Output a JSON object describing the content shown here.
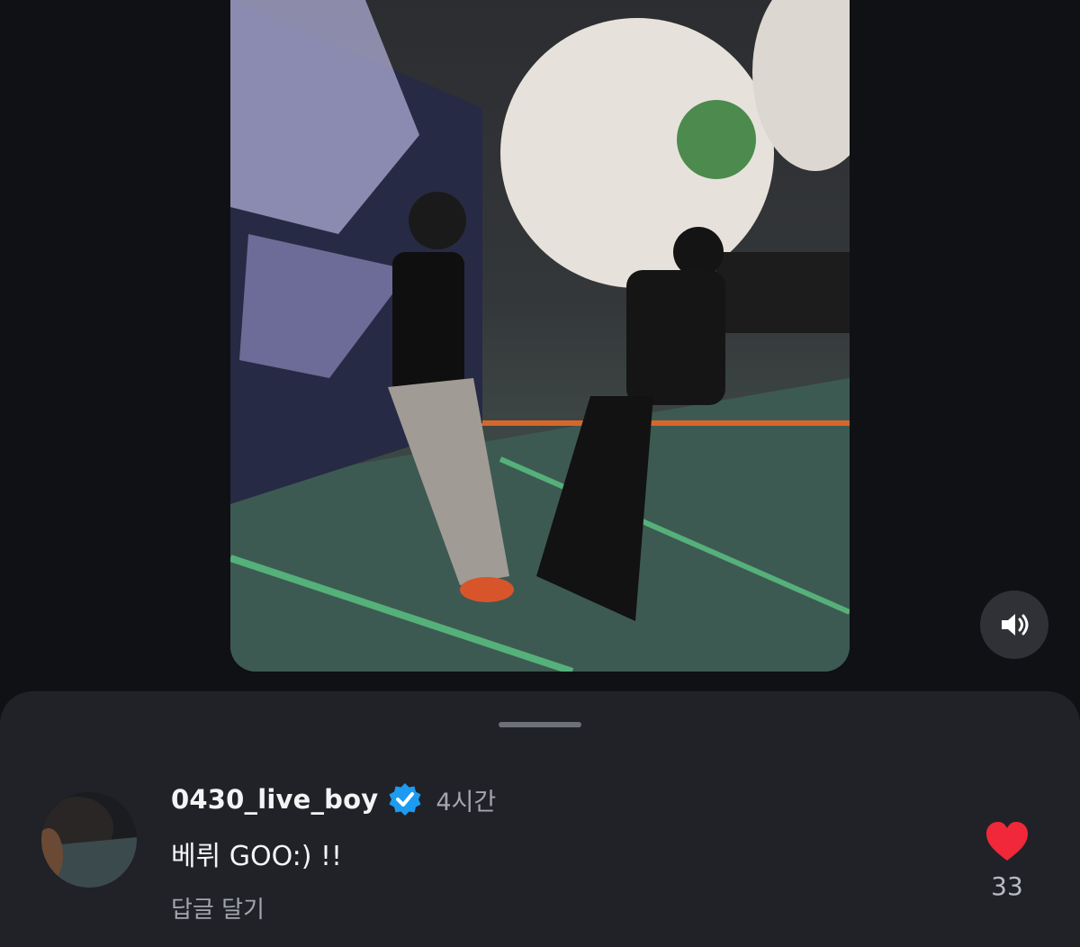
{
  "video": {
    "alt": "video",
    "sound": {
      "icon": "speaker-icon",
      "state": "on"
    }
  },
  "comment": {
    "username": "0430_live_boy",
    "verified_icon": "verified-badge-icon",
    "time": "4시간",
    "text": "베뤼 GOO:) !!",
    "reply_label": "답글 달기",
    "likes": {
      "icon": "heart-icon",
      "count": "33",
      "liked": true,
      "color": "#f0283a"
    }
  },
  "colors": {
    "background": "#0f1115",
    "sheet": "#202227",
    "verified": "#1d9bf0"
  }
}
